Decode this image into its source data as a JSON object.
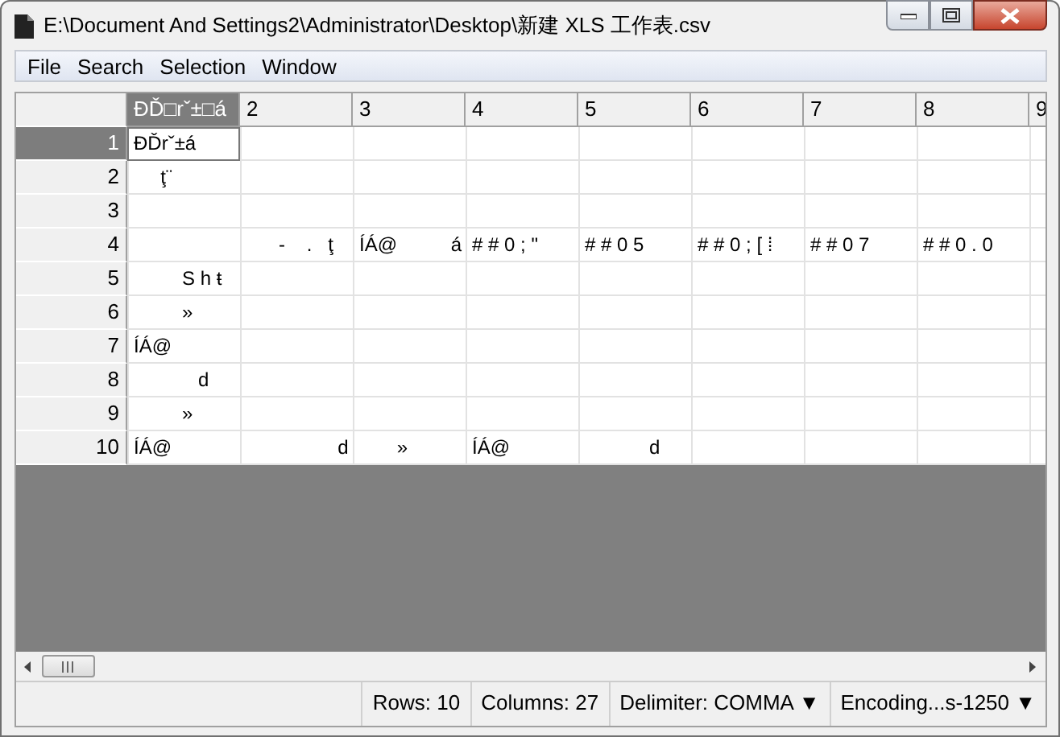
{
  "window": {
    "title": "E:\\Document And Settings2\\Administrator\\Desktop\\新建 XLS 工作表.csv"
  },
  "menu": [
    "File",
    "Search",
    "Selection",
    "Window"
  ],
  "table": {
    "columns": [
      {
        "label": "ĐĎ□rˇ±□á",
        "selected": true
      },
      {
        "label": "2",
        "selected": false
      },
      {
        "label": "3",
        "selected": false
      },
      {
        "label": "4",
        "selected": false
      },
      {
        "label": "5",
        "selected": false
      },
      {
        "label": "6",
        "selected": false
      },
      {
        "label": "7",
        "selected": false
      },
      {
        "label": "8",
        "selected": false
      },
      {
        "label": "9",
        "selected": false
      }
    ],
    "rows": [
      {
        "header": "1",
        "selected": true,
        "cells": [
          "ĐĎrˇ±á",
          null,
          null,
          null,
          null,
          null,
          null,
          null,
          null
        ]
      },
      {
        "header": "2",
        "selected": false,
        "cells": [
          "     ţ¨",
          null,
          null,
          null,
          null,
          null,
          null,
          null,
          null
        ]
      },
      {
        "header": "3",
        "selected": false,
        "cells": [
          null,
          null,
          null,
          null,
          null,
          null,
          null,
          null,
          null
        ]
      },
      {
        "header": "4",
        "selected": false,
        "cells": [
          null,
          "      -    .   ţ",
          "ÍÁ@          á",
          "# # 0 ; \"",
          "# # 0 5",
          "# # 0 ; [ ⁞",
          "# # 0 7",
          "# # 0 . 0",
          null
        ]
      },
      {
        "header": "5",
        "selected": false,
        "cells": [
          "         S h ŧ",
          null,
          null,
          null,
          null,
          null,
          null,
          null,
          null
        ]
      },
      {
        "header": "6",
        "selected": false,
        "cells": [
          "         »",
          null,
          null,
          null,
          null,
          null,
          null,
          null,
          null
        ]
      },
      {
        "header": "7",
        "selected": false,
        "cells": [
          "ÍÁ@",
          null,
          null,
          null,
          null,
          null,
          null,
          null,
          null
        ]
      },
      {
        "header": "8",
        "selected": false,
        "cells": [
          "            d",
          null,
          null,
          null,
          null,
          null,
          null,
          null,
          null
        ]
      },
      {
        "header": "9",
        "selected": false,
        "cells": [
          "         »",
          null,
          null,
          null,
          null,
          null,
          null,
          null,
          null
        ]
      },
      {
        "header": "10",
        "selected": false,
        "cells": [
          "ÍÁ@",
          "                 d",
          "       »",
          "ÍÁ@",
          "            d",
          null,
          null,
          null,
          null
        ]
      }
    ]
  },
  "status_bar": [
    "Rows: 10",
    "Columns: 27",
    "Delimiter: COMMA ▼",
    "Encoding...s-1250 ▼"
  ]
}
